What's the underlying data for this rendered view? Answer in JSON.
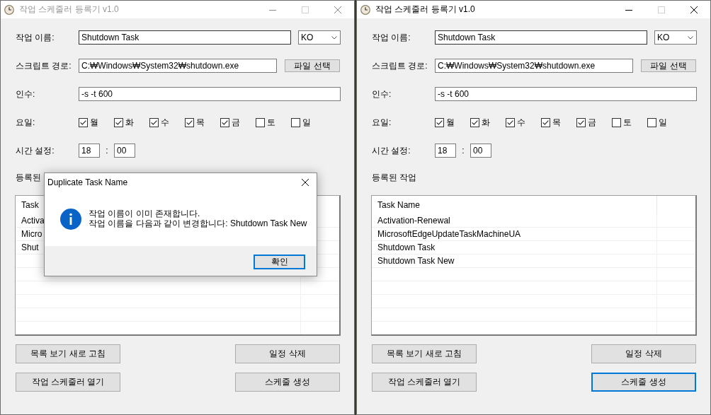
{
  "windows": [
    {
      "title": "작업 스케줄러 등록기 v1.0",
      "active": false,
      "maximize_disabled": true,
      "form": {
        "task_name": {
          "label": "작업 이름:",
          "value": "Shutdown Task",
          "focused": true
        },
        "language": {
          "value": "KO"
        },
        "script_path": {
          "label": "스크립트 경로:",
          "value": "C:₩Windows₩System32₩shutdown.exe",
          "button": "파일 선택"
        },
        "arguments": {
          "label": "인수:",
          "value": "-s -t 600"
        },
        "days": {
          "label": "요일:",
          "items": [
            {
              "label": "월",
              "checked": true
            },
            {
              "label": "화",
              "checked": true
            },
            {
              "label": "수",
              "checked": true
            },
            {
              "label": "목",
              "checked": true
            },
            {
              "label": "금",
              "checked": true
            },
            {
              "label": "토",
              "checked": false
            },
            {
              "label": "일",
              "checked": false
            }
          ]
        },
        "time": {
          "label": "시간 설정:",
          "hour": "18",
          "separator": ":",
          "minute": "00"
        }
      },
      "task_list": {
        "label": "등록된",
        "columns": [
          {
            "label": "Task"
          }
        ],
        "rows": [
          "Activa",
          "Micro",
          "Shut"
        ]
      },
      "buttons": [
        {
          "label": "목록 보기 새로 고침",
          "focused": false
        },
        {
          "label": "일정 삭제",
          "focused": false
        },
        {
          "label": "작업 스케줄러 열기",
          "focused": false
        },
        {
          "label": "스케줄 생성",
          "focused": false
        }
      ],
      "dialog": {
        "title": "Duplicate Task Name",
        "message_lines": [
          "작업 이름이 이미 존재합니다.",
          "작업 이름을 다음과 같이 변경합니다: Shutdown Task New"
        ],
        "button": {
          "label": "확인",
          "focused": true
        }
      }
    },
    {
      "title": "작업 스케줄러 등록기 v1.0",
      "active": true,
      "maximize_disabled": true,
      "form": {
        "task_name": {
          "label": "작업 이름:",
          "value": "Shutdown Task",
          "focused": true
        },
        "language": {
          "value": "KO"
        },
        "script_path": {
          "label": "스크립트 경로:",
          "value": "C:₩Windows₩System32₩shutdown.exe",
          "button": "파일 선택"
        },
        "arguments": {
          "label": "인수:",
          "value": "-s -t 600"
        },
        "days": {
          "label": "요일:",
          "items": [
            {
              "label": "월",
              "checked": true
            },
            {
              "label": "화",
              "checked": true
            },
            {
              "label": "수",
              "checked": true
            },
            {
              "label": "목",
              "checked": true
            },
            {
              "label": "금",
              "checked": true
            },
            {
              "label": "토",
              "checked": false
            },
            {
              "label": "일",
              "checked": false
            }
          ]
        },
        "time": {
          "label": "시간 설정:",
          "hour": "18",
          "separator": ":",
          "minute": "00"
        }
      },
      "task_list": {
        "label": "등록된 작업",
        "columns": [
          {
            "label": "Task Name"
          }
        ],
        "rows": [
          "Activation-Renewal",
          "MicrosoftEdgeUpdateTaskMachineUA",
          "Shutdown Task",
          "Shutdown Task New"
        ]
      },
      "buttons": [
        {
          "label": "목록 보기 새로 고침",
          "focused": false
        },
        {
          "label": "일정 삭제",
          "focused": false
        },
        {
          "label": "작업 스케줄러 열기",
          "focused": false
        },
        {
          "label": "스케줄 생성",
          "focused": true
        }
      ]
    }
  ]
}
